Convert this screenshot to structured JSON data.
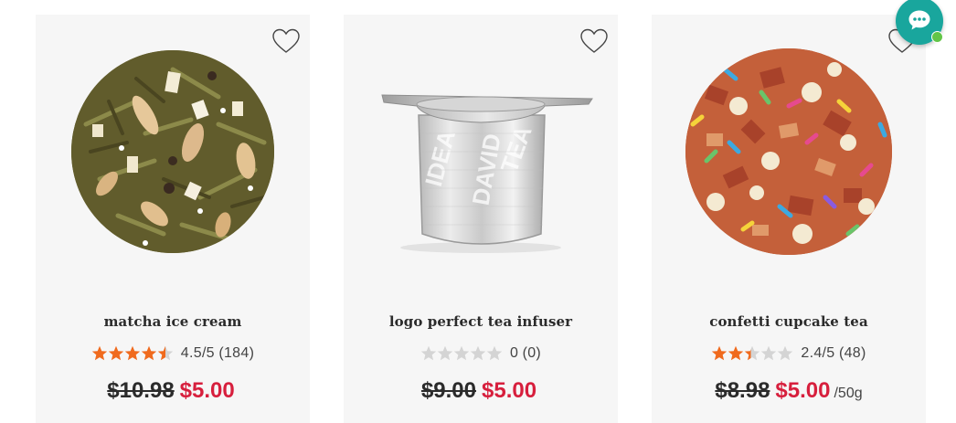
{
  "products": [
    {
      "name": "matcha ice cream",
      "rating_value": 4.5,
      "rating_text": "4.5/5",
      "review_count": "(184)",
      "old_price": "$10.98",
      "new_price": "$5.00",
      "unit": "",
      "image": "matcha-ice-cream-tea-leaves"
    },
    {
      "name": "logo perfect tea infuser",
      "rating_value": 0,
      "rating_text": "0",
      "review_count": "(0)",
      "old_price": "$9.00",
      "new_price": "$5.00",
      "unit": "",
      "image": "stainless-steel-tea-infuser"
    },
    {
      "name": "confetti cupcake tea",
      "rating_value": 2.4,
      "rating_text": "2.4/5",
      "review_count": "(48)",
      "old_price": "$8.98",
      "new_price": "$5.00",
      "unit": "/50g",
      "image": "confetti-cupcake-tea-blend"
    }
  ],
  "icons": {
    "wishlist": "heart-outline-icon",
    "star": "star-icon",
    "chat": "chat-bubble-icon"
  },
  "colors": {
    "card_bg": "#f6f6f6",
    "sale_price": "#d71f3d",
    "star_filled": "#f06a1d",
    "star_empty": "#d4d4d4",
    "chat_button": "#19a69d",
    "online_dot": "#63c548"
  }
}
